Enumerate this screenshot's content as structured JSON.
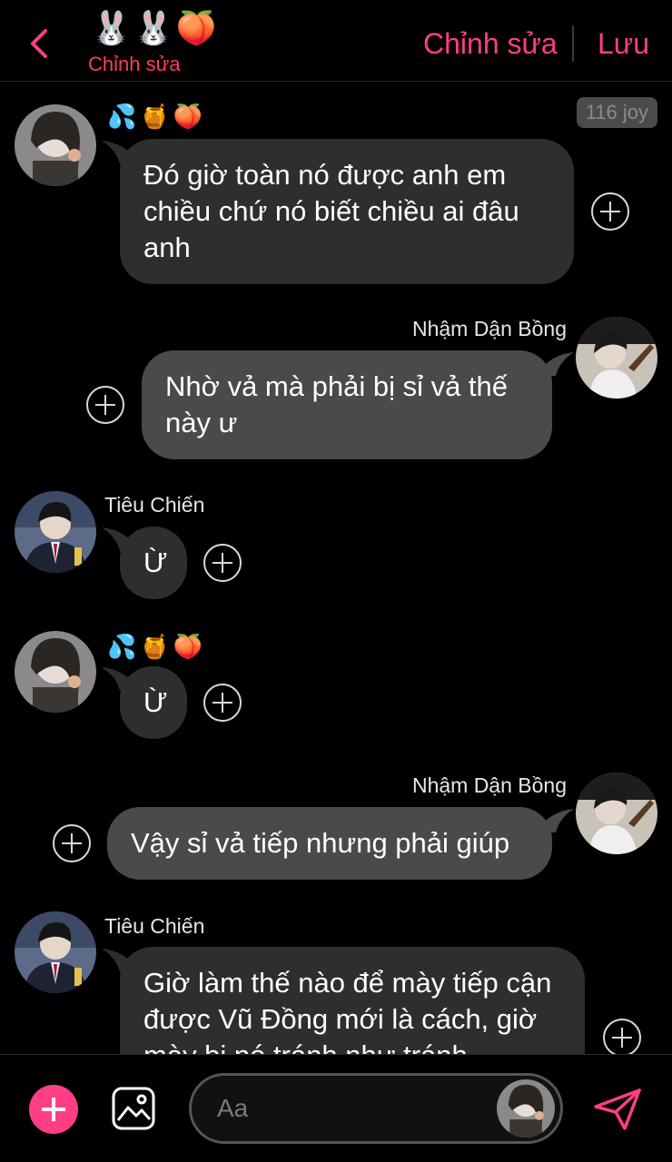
{
  "header": {
    "title_emojis": "🐰🐰🍑",
    "subtitle": "Chỉnh sửa",
    "edit_label": "Chỉnh sửa",
    "save_label": "Lưu"
  },
  "colors": {
    "accent": "#ff3e86",
    "subtitle": "#ff3b5c",
    "bubble_in": "#2e2e2e",
    "bubble_out": "#4a4a4a"
  },
  "messages": [
    {
      "side": "in",
      "sender": "💦🍯🍑",
      "badge": "116 joy",
      "text": "Đó giờ toàn nó được anh em chiều chứ nó biết chiều ai đâu anh"
    },
    {
      "side": "out",
      "sender": "Nhậm Dận Bồng",
      "text": "Nhờ vả mà phải bị sỉ vả thế này ư"
    },
    {
      "side": "in",
      "sender": "Tiêu Chiến",
      "text": "Ừ"
    },
    {
      "side": "in",
      "sender": "💦🍯🍑",
      "text": "Ừ"
    },
    {
      "side": "out",
      "sender": "Nhậm Dận Bồng",
      "text": "Vậy sỉ vả tiếp nhưng phải giúp"
    },
    {
      "side": "in",
      "sender": "Tiêu Chiến",
      "text": "Giờ làm thế nào để mày tiếp cận được Vũ Đồng mới là cách, giờ mày bị nó tránh như tránh"
    }
  ],
  "footer": {
    "input_placeholder": "Aa",
    "add_icon": "plus-icon",
    "image_icon": "image-icon",
    "send_icon": "send-icon"
  }
}
